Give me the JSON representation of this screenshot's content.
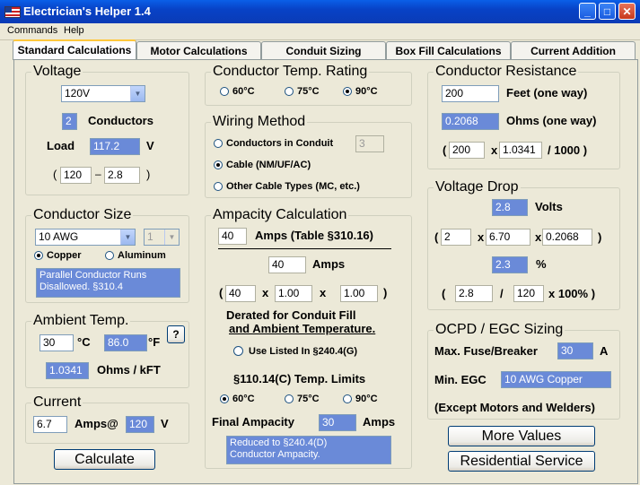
{
  "window": {
    "title": "Electrician's Helper 1.4",
    "min": "_",
    "max": "□",
    "close": "✕"
  },
  "menu": [
    "Commands",
    "Help"
  ],
  "tabs": [
    "Standard Calculations",
    "Motor Calculations",
    "Conduit Sizing",
    "Box Fill Calculations",
    "Current Addition"
  ],
  "voltage": {
    "title": "Voltage",
    "selected": "120V",
    "conductors_value": "2",
    "conductors_label": "Conductors",
    "load_label": "Load",
    "load_value": "117.2",
    "load_unit": "V",
    "open": "(",
    "left_value": "120",
    "minus": "–",
    "right_value": "2.8",
    "close": ")"
  },
  "conductor_size": {
    "title": "Conductor Size",
    "selected": "10 AWG",
    "parallel": "1",
    "copper": "Copper",
    "aluminum": "Aluminum",
    "notice_line1": "Parallel Conductor Runs",
    "notice_line2": "Disallowed.     §310.4"
  },
  "ambient": {
    "title": "Ambient Temp.",
    "celsius_value": "30",
    "celsius_unit": "°C",
    "fahrenheit_value": "86.0",
    "fahrenheit_unit": "°F",
    "help": "?",
    "factor_value": "1.0341",
    "factor_unit": "Ohms / kFT"
  },
  "current": {
    "title": "Current",
    "amps_value": "6.7",
    "amps_at": "Amps@",
    "volts_value": "120",
    "volts_unit": "V"
  },
  "calculate": "Calculate",
  "temp_rating": {
    "title": "Conductor Temp. Rating",
    "options": [
      "60°C",
      "75°C",
      "90°C"
    ]
  },
  "wiring": {
    "title": "Wiring Method",
    "conduit": "Conductors in Conduit",
    "conduit_count": "3",
    "cable": "Cable (NM/UF/AC)",
    "other": "Other Cable Types (MC, etc.)"
  },
  "ampacity": {
    "title": "Ampacity Calculation",
    "table_value": "40",
    "table_label": "Amps (Table §310.16)",
    "amps_value": "40",
    "amps_label": "Amps",
    "open": "(",
    "f1": "40",
    "x1": "x",
    "f2": "1.00",
    "x2": "x",
    "f3": "1.00",
    "close": ")",
    "derated1": "Derated for Conduit Fill",
    "derated2": "and Ambient Temperature.",
    "use_listed": "Use Listed In §240.4(G)",
    "limits_title": "§110.14(C) Temp. Limits",
    "limits": [
      "60°C",
      "75°C",
      "90°C"
    ],
    "final_label": "Final Ampacity",
    "final_value": "30",
    "final_unit": "Amps",
    "notice_line1": "Reduced to §240.4(D)",
    "notice_line2": "Conductor Ampacity."
  },
  "resistance": {
    "title": "Conductor Resistance",
    "feet_value": "200",
    "feet_label": "Feet  (one way)",
    "ohms_value": "0.2068",
    "ohms_label": "Ohms  (one way)",
    "open": "(",
    "a": "200",
    "x": "x",
    "b": "1.0341",
    "tail": "/ 1000 )"
  },
  "voltage_drop": {
    "title": "Voltage Drop",
    "volts_value": "2.8",
    "volts_label": "Volts",
    "open": "(",
    "a": "2",
    "x1": "x",
    "b": "6.70",
    "x2": "x",
    "c": "0.2068",
    "close": ")",
    "pct_value": "2.3",
    "pct_label": "%",
    "open2": "(",
    "d": "2.8",
    "slash": "/",
    "e": "120",
    "tail": "x 100% )"
  },
  "ocpd": {
    "title": "OCPD / EGC Sizing",
    "fuse_label": "Max. Fuse/Breaker",
    "fuse_value": "30",
    "fuse_unit": "A",
    "egc_label": "Min. EGC",
    "egc_value": "10 AWG Copper",
    "note": "(Except Motors and Welders)"
  },
  "more_values": "More Values",
  "residential": "Residential Service"
}
